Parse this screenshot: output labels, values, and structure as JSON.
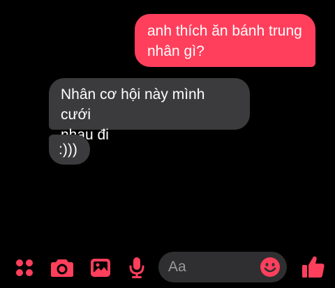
{
  "conversation": {
    "messages": [
      {
        "direction": "outgoing",
        "lines": [
          "anh thích ăn bánh trung",
          "nhân gì?"
        ]
      },
      {
        "direction": "incoming",
        "lines": [
          "Nhân cơ hội này mình cưới",
          "nhau đi"
        ]
      },
      {
        "direction": "incoming",
        "lines": [
          ":)))"
        ]
      }
    ]
  },
  "composer": {
    "placeholder": "Aa",
    "icons": [
      "menu-grid-icon",
      "camera-icon",
      "image-icon",
      "microphone-icon",
      "emoji-icon",
      "thumbs-up-icon"
    ]
  },
  "colors": {
    "accent": "#ff3f5c",
    "incoming_bubble": "#3b3b3d",
    "background": "#000000",
    "input_bg": "#2f2f31"
  }
}
